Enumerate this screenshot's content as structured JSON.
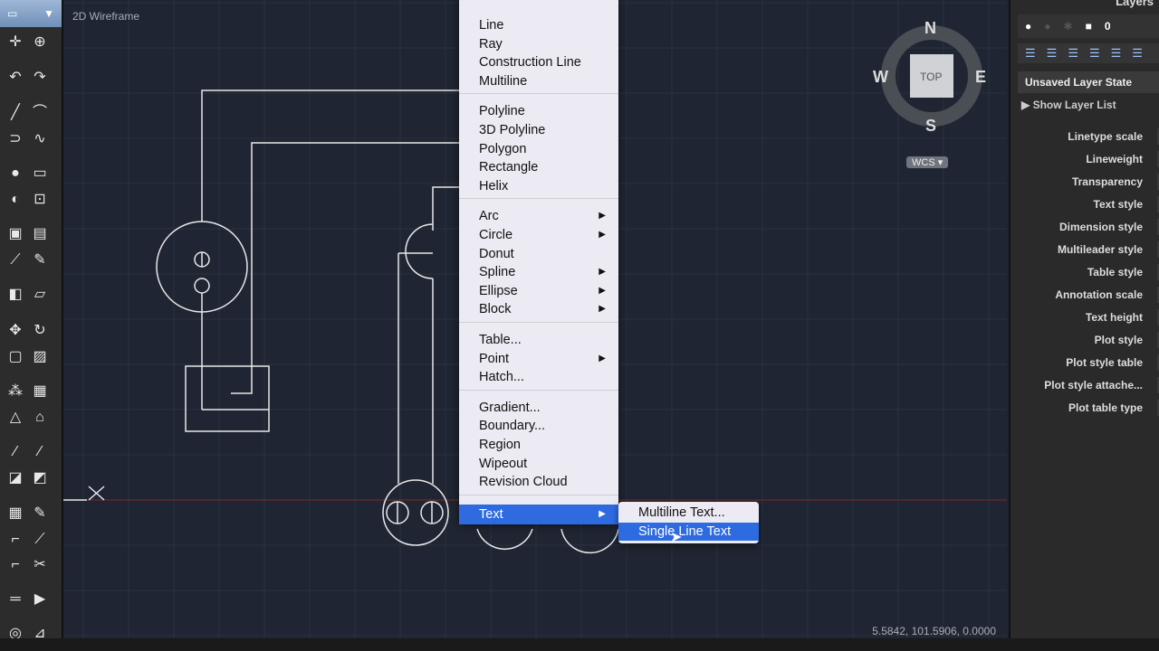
{
  "viewport": {
    "label": "2D Wireframe",
    "coords": "5.5842, 101.5906, 0.0000"
  },
  "compass": {
    "n": "N",
    "s": "S",
    "e": "E",
    "w": "W",
    "top": "TOP",
    "ucs": "WCS"
  },
  "menu": {
    "groups": [
      [
        {
          "label": "Line"
        },
        {
          "label": "Ray"
        },
        {
          "label": "Construction Line"
        },
        {
          "label": "Multiline"
        }
      ],
      [
        {
          "label": "Polyline"
        },
        {
          "label": "3D Polyline"
        },
        {
          "label": "Polygon"
        },
        {
          "label": "Rectangle"
        },
        {
          "label": "Helix"
        }
      ],
      [
        {
          "label": "Arc",
          "submenu": true
        },
        {
          "label": "Circle",
          "submenu": true
        },
        {
          "label": "Donut"
        },
        {
          "label": "Spline",
          "submenu": true
        },
        {
          "label": "Ellipse",
          "submenu": true
        },
        {
          "label": "Block",
          "submenu": true
        }
      ],
      [
        {
          "label": "Table..."
        },
        {
          "label": "Point",
          "submenu": true
        },
        {
          "label": "Hatch..."
        }
      ],
      [
        {
          "label": "Gradient..."
        },
        {
          "label": "Boundary..."
        },
        {
          "label": "Region"
        },
        {
          "label": "Wipeout"
        },
        {
          "label": "Revision Cloud"
        }
      ],
      [
        {
          "label": "Text",
          "submenu": true,
          "selected": true
        }
      ]
    ]
  },
  "submenu": {
    "items": [
      {
        "label": "Multiline Text..."
      },
      {
        "label": "Single Line Text",
        "selected": true
      }
    ]
  },
  "panel": {
    "title": "Layers",
    "current_layer": "0",
    "layer_state": "Unsaved Layer State",
    "show_layer_list": "Show Layer List",
    "properties": [
      "Linetype scale",
      "Lineweight",
      "Transparency",
      "Text style",
      "Dimension style",
      "Multileader style",
      "Table style",
      "Annotation scale",
      "Text height",
      "Plot style",
      "Plot style table",
      "Plot style attache...",
      "Plot table type"
    ]
  },
  "colors": {
    "selection": "#2f6be0",
    "axis_x": "#8b2a2a",
    "canvas": "#1f2532"
  }
}
